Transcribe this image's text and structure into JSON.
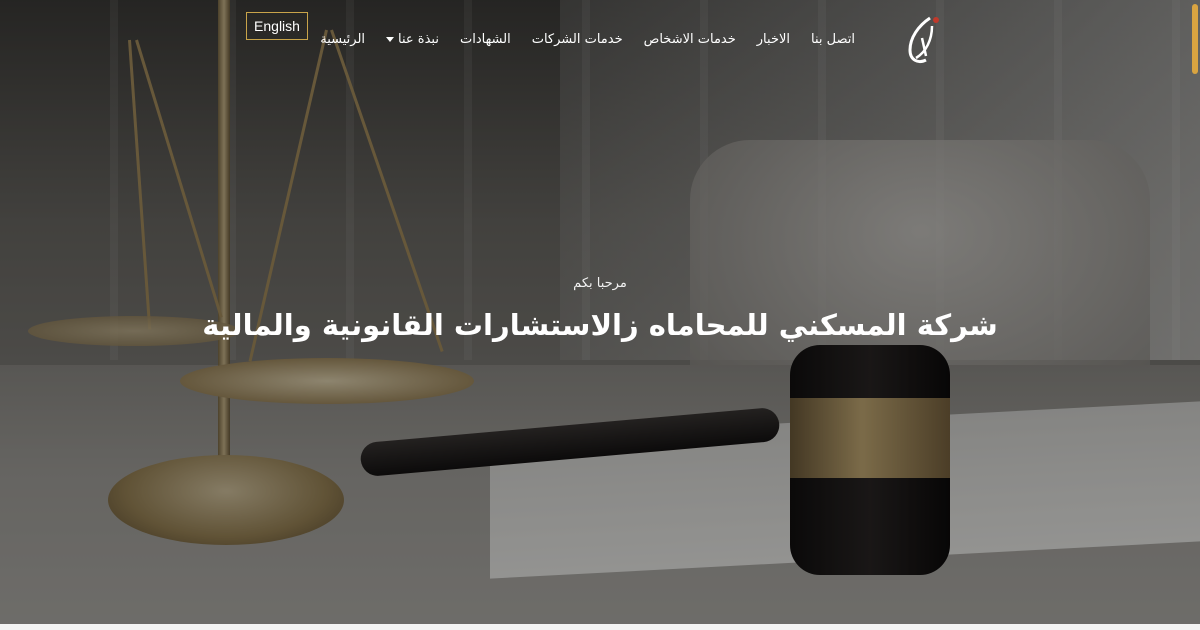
{
  "header": {
    "language_button": "English",
    "nav_items": [
      {
        "label": "الرئيسية",
        "has_dropdown": false
      },
      {
        "label": "نبذة عنا",
        "has_dropdown": true
      },
      {
        "label": "الشهادات",
        "has_dropdown": false
      },
      {
        "label": "خدمات الشركات",
        "has_dropdown": false
      },
      {
        "label": "خدمات الاشخاص",
        "has_dropdown": false
      },
      {
        "label": "الاخبار",
        "has_dropdown": false
      },
      {
        "label": "اتصل بنا",
        "has_dropdown": false
      }
    ]
  },
  "hero": {
    "welcome": "مرحبا بكم",
    "headline": "شركة المسكني للمحاماه زالاستشارات القانونية والمالية"
  },
  "colors": {
    "accent": "#c9a44a",
    "text": "#ffffff",
    "scrollbar": "#d9a441"
  }
}
